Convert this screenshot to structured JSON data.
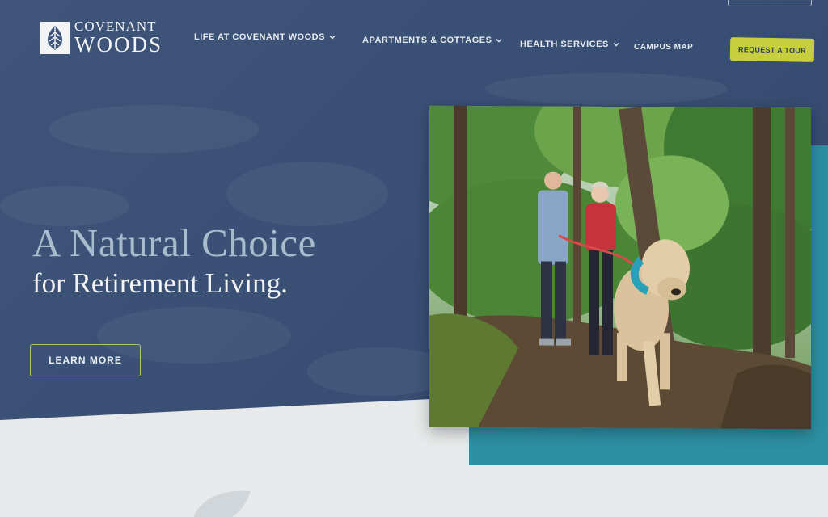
{
  "logo": {
    "line1": "COVENANT",
    "line2": "WOODS",
    "mark": "tree-leaf-icon"
  },
  "nav": {
    "items": [
      {
        "label": "LIFE AT COVENANT WOODS",
        "has_dropdown": true
      },
      {
        "label": "APARTMENTS & COTTAGES",
        "has_dropdown": true
      },
      {
        "label": "HEALTH SERVICES",
        "has_dropdown": true
      },
      {
        "label": "CAMPUS MAP",
        "has_dropdown": false
      }
    ],
    "cta": "REQUEST A TOUR"
  },
  "hero": {
    "headline": "A Natural Choice",
    "subheadline": "for Retirement Living.",
    "button": "LEARN MORE"
  },
  "colors": {
    "hero_bg": "#3c5277",
    "accent_yellow": "#c7cf3e",
    "teal": "#2d8fa3",
    "headline_light": "#a9bccd",
    "page_bg": "#e7e9ea"
  }
}
